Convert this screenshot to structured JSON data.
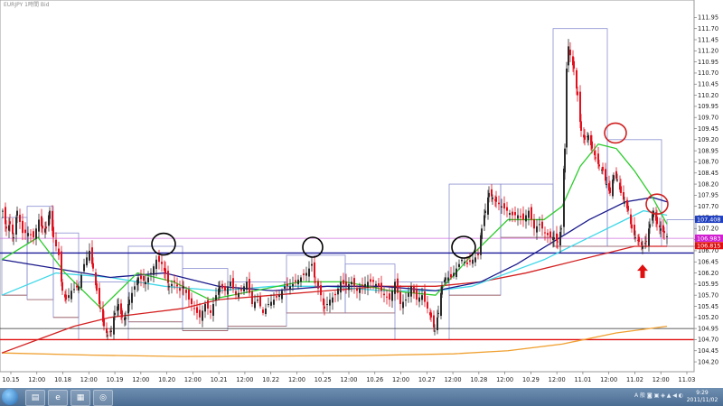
{
  "window": {
    "title": "EURJPY 1時間 Bid"
  },
  "taskbar": {
    "apps": [
      {
        "name": "folder",
        "glyph": "▤"
      },
      {
        "name": "browser",
        "glyph": "e"
      },
      {
        "name": "terminal",
        "glyph": "▦"
      },
      {
        "name": "app",
        "glyph": "◎"
      }
    ],
    "tray_text": "A 般 ◙ ▣ ◈ ▲ ◀ ◐",
    "time": "9:29",
    "date": "2011/11/02"
  },
  "colors": {
    "bull": "#2b2b2b",
    "bear": "#e0101e",
    "box": "#8a8fd0",
    "box_low": "#a06060",
    "ma_green": "#2ecc2e",
    "ma_cyan": "#40d8e8",
    "ma_navy": "#1a1a8c",
    "ma_red": "#d42020",
    "ma_orange": "#f0a030",
    "hline_blue": "#1a1a9a",
    "hline_magenta": "#d070e0",
    "hline_red": "#e01010",
    "label_blue": "#2040c0",
    "label_magenta": "#d020d0",
    "label_red": "#e01010",
    "circle_black": "#000000",
    "circle_red": "#d02020",
    "arrow": "#e01010"
  },
  "chart_data": {
    "type": "candlestick",
    "symbol": "EURJPY",
    "timeframe": "1時間",
    "ylim": [
      104.14,
      112.1
    ],
    "yticks": [
      "111.95",
      "111.70",
      "111.45",
      "111.20",
      "110.95",
      "110.70",
      "110.45",
      "110.20",
      "109.95",
      "109.70",
      "109.45",
      "109.20",
      "108.95",
      "108.70",
      "108.45",
      "108.20",
      "107.95",
      "107.70",
      "107.45",
      "107.20",
      "106.95",
      "106.70",
      "106.45",
      "106.20",
      "105.95",
      "105.70",
      "105.45",
      "105.20",
      "104.95",
      "104.70",
      "104.45",
      "104.20"
    ],
    "xticks": [
      "10.15",
      "12:00",
      "10.18",
      "12:00",
      "10.19",
      "12:00",
      "10.20",
      "12:00",
      "10.21",
      "12:00",
      "10.22",
      "12:00",
      "10.25",
      "12:00",
      "10.26",
      "12:00",
      "10.27",
      "12:00",
      "10.28",
      "12:00",
      "10.29",
      "12:00",
      "11.01",
      "12:00",
      "11.02",
      "12:00",
      "11.03"
    ],
    "price_labels": [
      {
        "text": "107.408",
        "value": 107.408,
        "color_key": "label_blue"
      },
      {
        "text": "106.983",
        "value": 106.983,
        "color_key": "label_magenta"
      },
      {
        "text": "106.815",
        "value": 106.815,
        "color_key": "label_red"
      }
    ],
    "close_path": [
      [
        0,
        107.6
      ],
      [
        4,
        107.2
      ],
      [
        8,
        107.3
      ],
      [
        12,
        107.0
      ],
      [
        16,
        107.6
      ],
      [
        22,
        107.1
      ],
      [
        28,
        107.1
      ],
      [
        34,
        107.0
      ],
      [
        40,
        107.4
      ],
      [
        44,
        107.2
      ],
      [
        48,
        107.2
      ],
      [
        52,
        107.6
      ],
      [
        56,
        107.0
      ],
      [
        62,
        106.6
      ],
      [
        66,
        105.8
      ],
      [
        70,
        105.6
      ],
      [
        76,
        105.8
      ],
      [
        84,
        105.9
      ],
      [
        90,
        106.4
      ],
      [
        96,
        106.7
      ],
      [
        100,
        106.3
      ],
      [
        104,
        105.8
      ],
      [
        108,
        105.4
      ],
      [
        112,
        105.0
      ],
      [
        116,
        104.8
      ],
      [
        120,
        104.9
      ],
      [
        124,
        105.3
      ],
      [
        128,
        105.5
      ],
      [
        132,
        105.2
      ],
      [
        136,
        105.2
      ],
      [
        140,
        105.6
      ],
      [
        146,
        105.9
      ],
      [
        150,
        106.1
      ],
      [
        158,
        106.0
      ],
      [
        164,
        106.2
      ],
      [
        170,
        106.5
      ],
      [
        176,
        106.4
      ],
      [
        180,
        106.2
      ],
      [
        184,
        105.9
      ],
      [
        190,
        106.0
      ],
      [
        196,
        105.8
      ],
      [
        200,
        105.9
      ],
      [
        206,
        105.6
      ],
      [
        212,
        105.4
      ],
      [
        218,
        105.2
      ],
      [
        224,
        105.5
      ],
      [
        230,
        105.3
      ],
      [
        236,
        105.7
      ],
      [
        240,
        105.9
      ],
      [
        246,
        105.8
      ],
      [
        252,
        106.0
      ],
      [
        258,
        105.7
      ],
      [
        264,
        105.8
      ],
      [
        270,
        106.0
      ],
      [
        276,
        105.5
      ],
      [
        282,
        105.6
      ],
      [
        288,
        105.3
      ],
      [
        294,
        105.5
      ],
      [
        300,
        105.6
      ],
      [
        306,
        105.7
      ],
      [
        312,
        105.9
      ],
      [
        318,
        105.9
      ],
      [
        324,
        106.0
      ],
      [
        330,
        106.1
      ],
      [
        336,
        106.2
      ],
      [
        342,
        106.4
      ],
      [
        346,
        106.0
      ],
      [
        352,
        105.7
      ],
      [
        356,
        105.4
      ],
      [
        362,
        105.6
      ],
      [
        368,
        105.7
      ],
      [
        374,
        106.0
      ],
      [
        380,
        105.9
      ],
      [
        386,
        106.0
      ],
      [
        392,
        105.8
      ],
      [
        398,
        105.9
      ],
      [
        404,
        106.0
      ],
      [
        410,
        106.0
      ],
      [
        416,
        105.9
      ],
      [
        422,
        105.7
      ],
      [
        428,
        105.6
      ],
      [
        434,
        106.0
      ],
      [
        440,
        105.5
      ],
      [
        446,
        105.6
      ],
      [
        452,
        105.9
      ],
      [
        458,
        105.6
      ],
      [
        464,
        105.7
      ],
      [
        470,
        105.4
      ],
      [
        474,
        105.2
      ],
      [
        478,
        104.9
      ],
      [
        482,
        105.3
      ],
      [
        486,
        105.9
      ],
      [
        490,
        106.1
      ],
      [
        496,
        106.1
      ],
      [
        502,
        106.3
      ],
      [
        508,
        106.5
      ],
      [
        514,
        106.4
      ],
      [
        520,
        106.5
      ],
      [
        526,
        106.6
      ],
      [
        530,
        107.2
      ],
      [
        534,
        107.6
      ],
      [
        538,
        108.0
      ],
      [
        542,
        107.9
      ],
      [
        546,
        107.8
      ],
      [
        552,
        107.7
      ],
      [
        558,
        107.6
      ],
      [
        564,
        107.5
      ],
      [
        570,
        107.5
      ],
      [
        576,
        107.4
      ],
      [
        582,
        107.6
      ],
      [
        588,
        107.2
      ],
      [
        594,
        107.3
      ],
      [
        600,
        107.1
      ],
      [
        606,
        107.0
      ],
      [
        610,
        107.0
      ],
      [
        614,
        106.9
      ],
      [
        618,
        107.2
      ],
      [
        622,
        109.0
      ],
      [
        624,
        110.8
      ],
      [
        626,
        111.3
      ],
      [
        628,
        111.1
      ],
      [
        632,
        110.8
      ],
      [
        636,
        110.2
      ],
      [
        640,
        109.4
      ],
      [
        644,
        109.2
      ],
      [
        648,
        109.3
      ],
      [
        652,
        109.0
      ],
      [
        656,
        108.8
      ],
      [
        660,
        108.6
      ],
      [
        664,
        108.5
      ],
      [
        668,
        108.2
      ],
      [
        672,
        108.0
      ],
      [
        676,
        108.4
      ],
      [
        680,
        108.3
      ],
      [
        684,
        108.0
      ],
      [
        688,
        107.8
      ],
      [
        692,
        107.6
      ],
      [
        696,
        107.2
      ],
      [
        700,
        107.0
      ],
      [
        704,
        106.9
      ],
      [
        708,
        106.8
      ],
      [
        712,
        106.9
      ],
      [
        716,
        107.3
      ],
      [
        720,
        107.6
      ],
      [
        724,
        107.3
      ],
      [
        728,
        107.2
      ],
      [
        732,
        107.1
      ],
      [
        736,
        107.0
      ]
    ],
    "ma_green": [
      [
        0,
        106.5
      ],
      [
        40,
        107.0
      ],
      [
        70,
        106.2
      ],
      [
        110,
        105.4
      ],
      [
        150,
        106.2
      ],
      [
        190,
        106.0
      ],
      [
        230,
        105.6
      ],
      [
        280,
        105.8
      ],
      [
        330,
        106.0
      ],
      [
        380,
        106.0
      ],
      [
        430,
        105.8
      ],
      [
        480,
        105.7
      ],
      [
        520,
        106.6
      ],
      [
        560,
        107.4
      ],
      [
        600,
        107.4
      ],
      [
        620,
        107.7
      ],
      [
        640,
        108.6
      ],
      [
        660,
        109.1
      ],
      [
        680,
        109.0
      ],
      [
        700,
        108.5
      ],
      [
        720,
        107.9
      ],
      [
        736,
        107.3
      ]
    ],
    "ma_cyan": [
      [
        0,
        105.7
      ],
      [
        60,
        106.2
      ],
      [
        120,
        106.1
      ],
      [
        180,
        105.9
      ],
      [
        240,
        105.8
      ],
      [
        300,
        105.9
      ],
      [
        360,
        105.9
      ],
      [
        420,
        105.8
      ],
      [
        480,
        105.8
      ],
      [
        520,
        105.9
      ],
      [
        560,
        106.2
      ],
      [
        600,
        106.5
      ],
      [
        640,
        106.9
      ],
      [
        680,
        107.3
      ],
      [
        710,
        107.6
      ],
      [
        736,
        107.5
      ]
    ],
    "ma_navy": [
      [
        0,
        106.5
      ],
      [
        60,
        106.3
      ],
      [
        120,
        106.1
      ],
      [
        180,
        106.2
      ],
      [
        240,
        105.9
      ],
      [
        300,
        105.8
      ],
      [
        360,
        105.9
      ],
      [
        420,
        105.9
      ],
      [
        480,
        105.8
      ],
      [
        530,
        106.0
      ],
      [
        570,
        106.4
      ],
      [
        610,
        106.9
      ],
      [
        650,
        107.4
      ],
      [
        690,
        107.8
      ],
      [
        720,
        107.9
      ],
      [
        736,
        107.8
      ]
    ],
    "ma_red": [
      [
        0,
        104.4
      ],
      [
        40,
        104.7
      ],
      [
        80,
        105.0
      ],
      [
        120,
        105.2
      ],
      [
        160,
        105.3
      ],
      [
        200,
        105.4
      ],
      [
        240,
        105.6
      ],
      [
        300,
        105.7
      ],
      [
        360,
        105.8
      ],
      [
        420,
        105.9
      ],
      [
        480,
        105.9
      ],
      [
        530,
        106.0
      ],
      [
        580,
        106.2
      ],
      [
        620,
        106.4
      ],
      [
        660,
        106.6
      ],
      [
        700,
        106.8
      ],
      [
        736,
        106.8
      ]
    ],
    "ma_orange": [
      [
        0,
        104.4
      ],
      [
        100,
        104.35
      ],
      [
        200,
        104.32
      ],
      [
        300,
        104.33
      ],
      [
        400,
        104.34
      ],
      [
        500,
        104.38
      ],
      [
        560,
        104.45
      ],
      [
        620,
        104.6
      ],
      [
        680,
        104.85
      ],
      [
        736,
        105.0
      ]
    ],
    "hlines": [
      {
        "value": 106.65,
        "color_key": "hline_blue",
        "width": 1.4
      },
      {
        "value": 106.98,
        "color_key": "hline_magenta",
        "width": 0.8
      },
      {
        "value": 104.95,
        "color_key": "bull",
        "width": 0.8
      },
      {
        "value": 104.7,
        "color_key": "hline_red",
        "width": 1.4
      }
    ],
    "daily_boxes": [
      {
        "x0": 0,
        "x1": 28,
        "high": 107.45,
        "low": 105.7
      },
      {
        "x0": 28,
        "x1": 57,
        "high": 107.7,
        "low": 105.6
      },
      {
        "x0": 57,
        "x1": 85,
        "high": 107.1,
        "low": 105.2
      },
      {
        "x0": 85,
        "x1": 140,
        "high": 106.0,
        "low": 104.7
      },
      {
        "x0": 140,
        "x1": 200,
        "high": 106.8,
        "low": 105.1
      },
      {
        "x0": 200,
        "x1": 250,
        "high": 106.3,
        "low": 104.9
      },
      {
        "x0": 250,
        "x1": 315,
        "high": 106.0,
        "low": 105.0
      },
      {
        "x0": 315,
        "x1": 380,
        "high": 106.6,
        "low": 105.3
      },
      {
        "x0": 380,
        "x1": 435,
        "high": 106.4,
        "low": 105.3
      },
      {
        "x0": 435,
        "x1": 495,
        "high": 106.0,
        "low": 104.7
      },
      {
        "x0": 495,
        "x1": 552,
        "high": 108.2,
        "low": 105.7
      },
      {
        "x0": 552,
        "x1": 610,
        "high": 108.2,
        "low": 107.0
      },
      {
        "x0": 610,
        "x1": 670,
        "high": 111.7,
        "low": 106.8
      },
      {
        "x0": 670,
        "x1": 730,
        "high": 109.2,
        "low": 106.8
      },
      {
        "x0": 736,
        "x1": 768,
        "high": 107.4,
        "low": 106.8
      }
    ],
    "annotations": [
      {
        "shape": "ellipse",
        "x": 179,
        "value": 106.85,
        "rx": 13,
        "ry": 12,
        "color_key": "circle_black"
      },
      {
        "shape": "ellipse",
        "x": 344,
        "value": 106.78,
        "rx": 11,
        "ry": 11,
        "color_key": "circle_black"
      },
      {
        "shape": "ellipse",
        "x": 511,
        "value": 106.78,
        "rx": 13,
        "ry": 12,
        "color_key": "circle_black"
      },
      {
        "shape": "ellipse",
        "x": 679,
        "value": 109.35,
        "rx": 12,
        "ry": 11,
        "color_key": "circle_red"
      },
      {
        "shape": "ellipse",
        "x": 725,
        "value": 107.75,
        "rx": 12,
        "ry": 11,
        "color_key": "circle_red"
      },
      {
        "shape": "arrow-up",
        "x": 709,
        "value": 106.25,
        "color_key": "arrow"
      }
    ]
  }
}
